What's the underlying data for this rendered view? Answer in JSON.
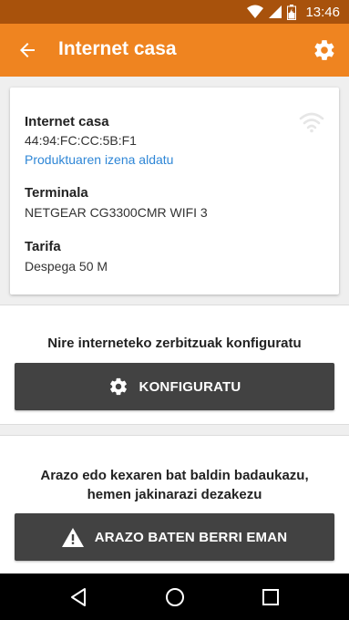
{
  "status_bar": {
    "time": "13:46"
  },
  "app_bar": {
    "title": "Internet casa"
  },
  "card": {
    "name": "Internet casa",
    "mac": "44:94:FC:CC:5B:F1",
    "rename_link": "Produktuaren izena aldatu",
    "terminal_label": "Terminala",
    "terminal_value": "NETGEAR CG3300CMR WIFI 3",
    "tariff_label": "Tarifa",
    "tariff_value": "Despega 50 M"
  },
  "configure_section": {
    "text": "Nire interneteko zerbitzuak konfiguratu",
    "button_label": "KONFIGURATU"
  },
  "report_section": {
    "text_line1": "Arazo edo kexaren bat baldin badaukazu,",
    "text_line2": "hemen jakinarazi dezakezu",
    "button_label": "ARAZO BATEN BERRI EMAN"
  },
  "colors": {
    "app_bar": "#ef8420",
    "status_bar": "#a8520c",
    "link": "#2e86d6",
    "button": "#424242"
  },
  "icons": [
    "wifi-icon",
    "cell-signal-icon",
    "battery-icon",
    "back-arrow-icon",
    "gear-icon",
    "wifi-signal-icon",
    "warning-icon",
    "nav-back-icon",
    "nav-home-icon",
    "nav-recents-icon"
  ]
}
